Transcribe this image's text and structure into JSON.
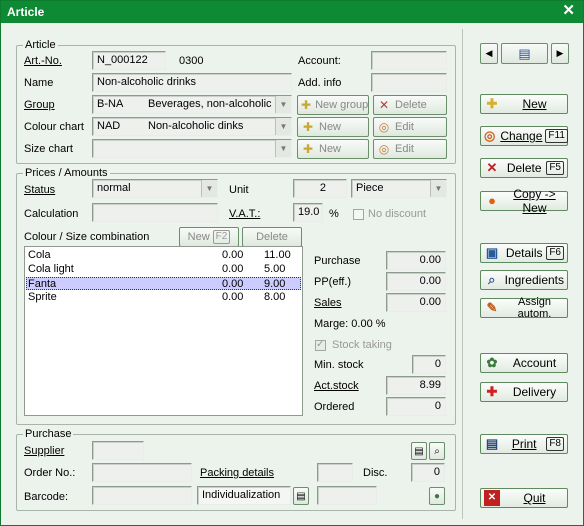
{
  "window": {
    "title": "Article",
    "close": "✕"
  },
  "article": {
    "legend": "Article",
    "art_no_label": "Art.-No.",
    "art_no": "N_000122",
    "art_code": "0300",
    "account_label": "Account:",
    "name_label": "Name",
    "name": "Non-alcoholic drinks",
    "add_info_label": "Add. info",
    "group_label": "Group",
    "group_code": "B-NA",
    "group_name": "Beverages, non-alcoholic",
    "colour_chart_label": "Colour chart",
    "colour_code": "NAD",
    "colour_name": "Non-alcoholic dinks",
    "size_chart_label": "Size chart",
    "new_group": "New group",
    "delete": "Delete",
    "new": "New",
    "edit": "Edit"
  },
  "prices": {
    "legend": "Prices / Amounts",
    "status_label": "Status",
    "status": "normal",
    "unit_label": "Unit",
    "unit_qty": "2",
    "unit": "Piece",
    "calc_label": "Calculation",
    "vat_label": "V.A.T.:",
    "vat": "19.0",
    "pct": "%",
    "no_discount": "No discount",
    "combo_label": "Colour / Size combination",
    "new_f2": "New",
    "new_key": "F2",
    "delete": "Delete",
    "purchase_label": "Purchase",
    "purchase": "0.00",
    "pp_label": "PP(eff.)",
    "pp": "0.00",
    "sales_label": "Sales",
    "sales": "0.00",
    "marge": "Marge: 0.00 %",
    "stock_taking": "Stock taking",
    "min_stock_label": "Min. stock",
    "min_stock": "0",
    "act_stock_label": "Act.stock",
    "act_stock": "8.99",
    "ordered_label": "Ordered",
    "ordered": "0"
  },
  "combos": [
    {
      "name": "Cola",
      "c1": "0.00",
      "c2": "11.00"
    },
    {
      "name": "Cola light",
      "c1": "0.00",
      "c2": "5.00"
    },
    {
      "name": "Fanta",
      "c1": "0.00",
      "c2": "9.00"
    },
    {
      "name": "Sprite",
      "c1": "0.00",
      "c2": "8.00"
    }
  ],
  "purchase": {
    "legend": "Purchase",
    "supplier_label": "Supplier",
    "order_no_label": "Order No.:",
    "packing_label": "Packing details",
    "disc_label": "Disc.",
    "disc": "0",
    "barcode_label": "Barcode:",
    "individualization": "Individualization"
  },
  "actions": {
    "new": "New",
    "change": "Change",
    "change_key": "F11",
    "delete": "Delete",
    "delete_key": "F5",
    "copy": "Copy -> New",
    "details": "Details",
    "details_key": "F6",
    "ingredients": "Ingredients",
    "assign": "Assign autom.",
    "account": "Account",
    "delivery": "Delivery",
    "print": "Print",
    "print_key": "F8",
    "quit": "Quit"
  },
  "colors": {
    "title_bar": "#0f8a34",
    "selection": "#ccccff"
  }
}
